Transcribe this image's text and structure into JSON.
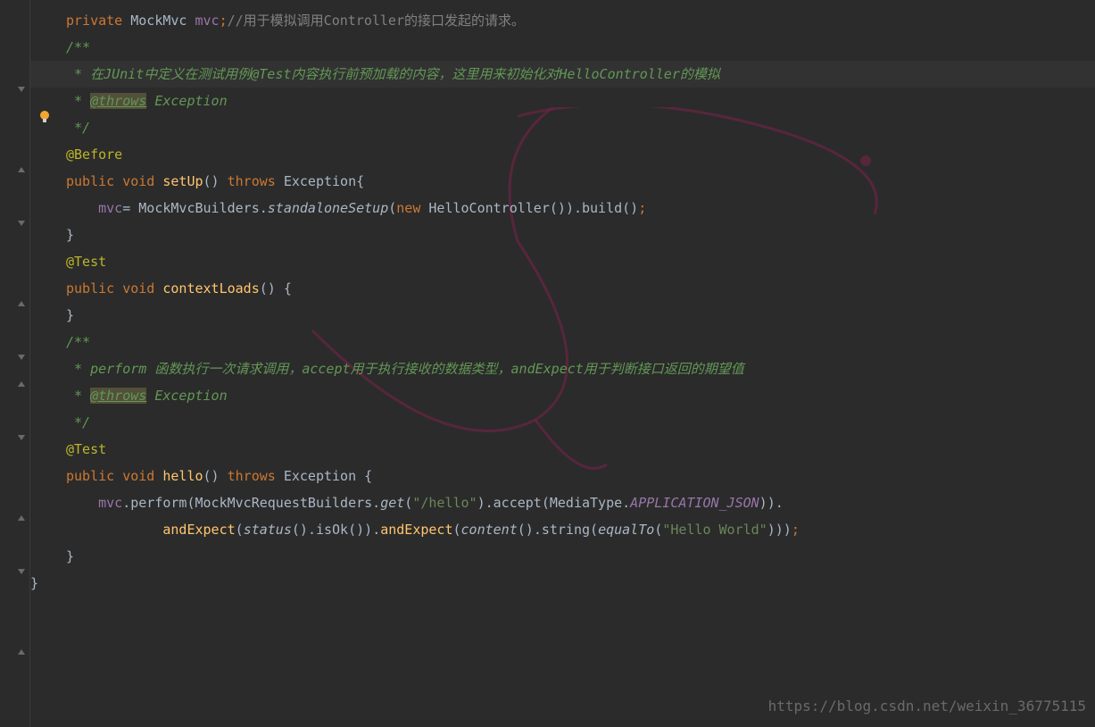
{
  "code": {
    "line1": {
      "kw_private": "private",
      "type": "MockMvc",
      "field": "mvc",
      "semi": ";",
      "comment": "//用于模拟调用Controller的接口发起的请求。"
    },
    "doc1": {
      "open": "/**",
      "body": " * 在JUnit中定义在测试用例@Test内容执行前预加载的内容，这里用来初始化对HelloController的模拟",
      "throws_prefix": " * ",
      "throws_tag": "@throws",
      "throws_type": " Exception",
      "close": " */"
    },
    "before": {
      "annotation": "@Before",
      "kw_public": "public",
      "kw_void": "void",
      "method": "setUp",
      "parens": "()",
      "kw_throws": "throws",
      "exception": "Exception",
      "brace": "{"
    },
    "setup_body": {
      "field": "mvc",
      "eq": "=",
      "builders": "MockMvcBuilders.",
      "standalone": "standaloneSetup",
      "lparen": "(",
      "kw_new": "new",
      "ctrl": "HelloController",
      "ctrl_parens": "()",
      "rparen": ")",
      "dot_build": ".build",
      "build_parens": "()",
      "semi": ";"
    },
    "close_brace1": "}",
    "test1": {
      "annotation": "@Test",
      "kw_public": "public",
      "kw_void": "void",
      "method": "contextLoads",
      "parens": "()",
      "brace": " {"
    },
    "close_brace2": "}",
    "doc2": {
      "open": "/**",
      "body": " * perform 函数执行一次请求调用，accept用于执行接收的数据类型，andExpect用于判断接口返回的期望值",
      "throws_prefix": " * ",
      "throws_tag": "@throws",
      "throws_type": " Exception",
      "close": " */"
    },
    "test2": {
      "annotation": "@Test",
      "kw_public": "public",
      "kw_void": "void",
      "method": "hello",
      "parens": "()",
      "kw_throws": "throws",
      "exception": "Exception",
      "brace": " {"
    },
    "hello_body1": {
      "field": "mvc",
      "perform": ".perform(MockMvcRequestBuilders.",
      "get": "get",
      "lparen": "(",
      "url": "\"/hello\"",
      "rparen": ")",
      "accept": ".accept(MediaType.",
      "json": "APPLICATION_JSON",
      "close": ")).",
      "close_rparen": ")"
    },
    "hello_body2": {
      "andExpect1": "andExpect",
      "lparen1": "(",
      "status": "status",
      "status_parens": "()",
      "isOk": ".isOk",
      "isOk_parens": "()",
      "rparen1": ")",
      "dot": ".",
      "andExpect2": "andExpect",
      "lparen2": "(",
      "content": "content",
      "content_parens": "()",
      "string_method": ".string(",
      "equalTo": "equalTo",
      "lparen3": "(",
      "hello_world": "\"Hello World\"",
      "close": ")))",
      "semi": ";"
    },
    "close_brace3": "}",
    "close_brace4": "}"
  },
  "watermark": "https://blog.csdn.net/weixin_36775115"
}
